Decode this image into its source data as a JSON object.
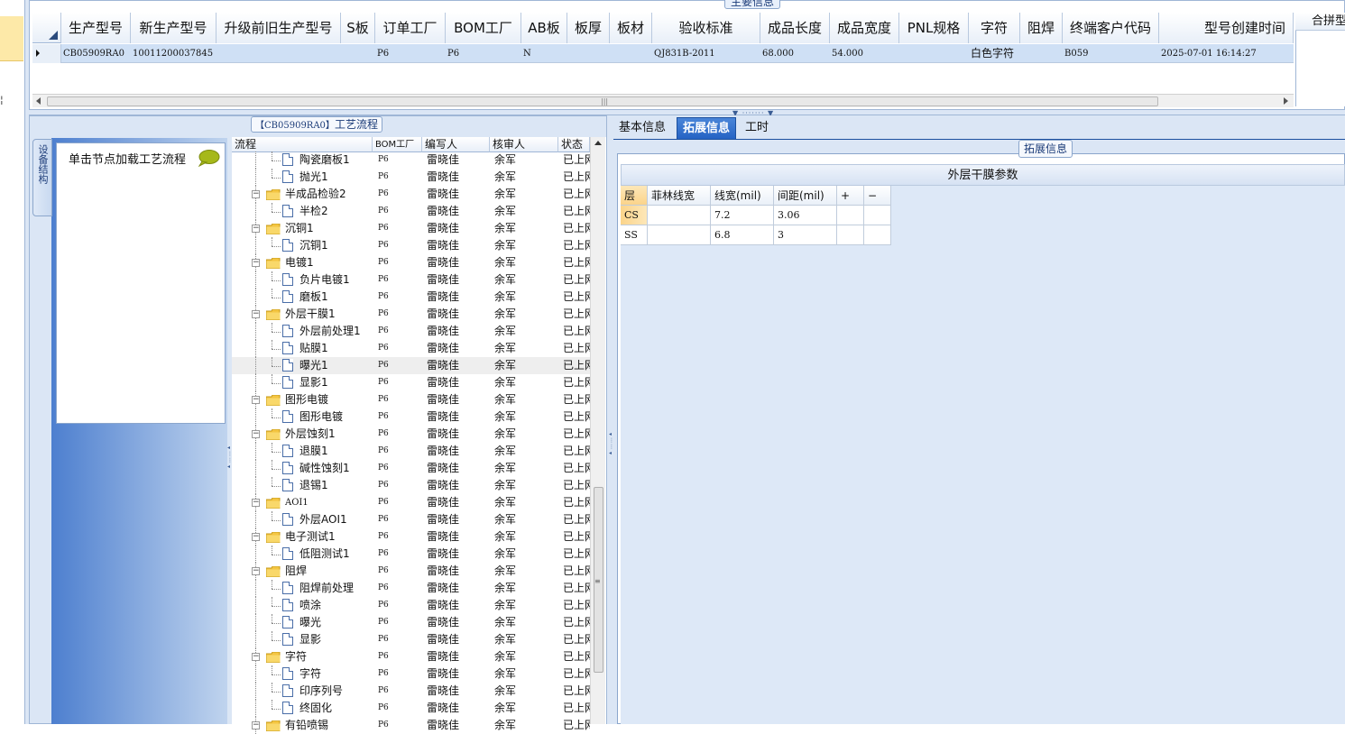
{
  "left_strip": {
    "glyph": "¦"
  },
  "top_group": {
    "title": "主要信息",
    "columns": [
      "生产型号",
      "新生产型号",
      "升级前旧生产型号",
      "S板",
      "订单工厂",
      "BOM工厂",
      "AB板",
      "板厚",
      "板材",
      "验收标准",
      "成品长度",
      "成品宽度",
      "PNL规格",
      "字符",
      "阻焊",
      "终端客户代码",
      "型号创建时间"
    ],
    "row": {
      "prod_model": "CB05909RA0",
      "new_model": "10011200037845",
      "old_model": "",
      "s_board": "",
      "order_factory": "P6",
      "bom_factory": "P6",
      "ab_board": "N",
      "thickness": "",
      "material": "",
      "standard": "QJ831B-2011",
      "length": "68.000",
      "width": "54.000",
      "pnl": "",
      "char": "白色字符",
      "solder": "",
      "customer_code": "B059",
      "created": "2025-07-01 16:14:27"
    },
    "merge_header": "合拼型"
  },
  "flow_group": {
    "title_code": "【CB05909RA0】",
    "title_text": "工艺流程",
    "vtab_label": "设备结构",
    "hint": "单击节点加载工艺流程",
    "columns": {
      "process": "流程",
      "bom": "BOM工厂",
      "writer": "编写人",
      "reviewer": "核审人",
      "status": "状态"
    },
    "rows": [
      {
        "name": "陶瓷磨板1",
        "level": 2,
        "factory": "P6",
        "writer": "雷晓佳",
        "reviewer": "余军",
        "status": "已上网"
      },
      {
        "name": "抛光1",
        "level": 2,
        "factory": "P6",
        "writer": "雷晓佳",
        "reviewer": "余军",
        "status": "已上网"
      },
      {
        "name": "半成品检验2",
        "level": 1,
        "factory": "P6",
        "writer": "雷晓佳",
        "reviewer": "余军",
        "status": "已上网"
      },
      {
        "name": "半检2",
        "level": 2,
        "factory": "P6",
        "writer": "雷晓佳",
        "reviewer": "余军",
        "status": "已上网"
      },
      {
        "name": "沉铜1",
        "level": 1,
        "factory": "P6",
        "writer": "雷晓佳",
        "reviewer": "余军",
        "status": "已上网"
      },
      {
        "name": "沉铜1",
        "level": 2,
        "factory": "P6",
        "writer": "雷晓佳",
        "reviewer": "余军",
        "status": "已上网"
      },
      {
        "name": "电镀1",
        "level": 1,
        "factory": "P6",
        "writer": "雷晓佳",
        "reviewer": "余军",
        "status": "已上网"
      },
      {
        "name": "负片电镀1",
        "level": 2,
        "factory": "P6",
        "writer": "雷晓佳",
        "reviewer": "余军",
        "status": "已上网"
      },
      {
        "name": "磨板1",
        "level": 2,
        "factory": "P6",
        "writer": "雷晓佳",
        "reviewer": "余军",
        "status": "已上网"
      },
      {
        "name": "外层干膜1",
        "level": 1,
        "factory": "P6",
        "writer": "雷晓佳",
        "reviewer": "余军",
        "status": "已上网"
      },
      {
        "name": "外层前处理1",
        "level": 2,
        "factory": "P6",
        "writer": "雷晓佳",
        "reviewer": "余军",
        "status": "已上网"
      },
      {
        "name": "贴膜1",
        "level": 2,
        "factory": "P6",
        "writer": "雷晓佳",
        "reviewer": "余军",
        "status": "已上网"
      },
      {
        "name": "曝光1",
        "level": 2,
        "factory": "P6",
        "writer": "雷晓佳",
        "reviewer": "余军",
        "status": "已上网",
        "selected": true
      },
      {
        "name": "显影1",
        "level": 2,
        "factory": "P6",
        "writer": "雷晓佳",
        "reviewer": "余军",
        "status": "已上网"
      },
      {
        "name": "图形电镀",
        "level": 1,
        "factory": "P6",
        "writer": "雷晓佳",
        "reviewer": "余军",
        "status": "已上网"
      },
      {
        "name": "图形电镀",
        "level": 2,
        "factory": "P6",
        "writer": "雷晓佳",
        "reviewer": "余军",
        "status": "已上网"
      },
      {
        "name": "外层蚀刻1",
        "level": 1,
        "factory": "P6",
        "writer": "雷晓佳",
        "reviewer": "余军",
        "status": "已上网"
      },
      {
        "name": "退膜1",
        "level": 2,
        "factory": "P6",
        "writer": "雷晓佳",
        "reviewer": "余军",
        "status": "已上网"
      },
      {
        "name": "碱性蚀刻1",
        "level": 2,
        "factory": "P6",
        "writer": "雷晓佳",
        "reviewer": "余军",
        "status": "已上网"
      },
      {
        "name": "退锡1",
        "level": 2,
        "factory": "P6",
        "writer": "雷晓佳",
        "reviewer": "余军",
        "status": "已上网"
      },
      {
        "name": "AOI1",
        "level": 1,
        "factory": "P6",
        "writer": "雷晓佳",
        "reviewer": "余军",
        "status": "已上网"
      },
      {
        "name": "外层AOI1",
        "level": 2,
        "factory": "P6",
        "writer": "雷晓佳",
        "reviewer": "余军",
        "status": "已上网"
      },
      {
        "name": "电子测试1",
        "level": 1,
        "factory": "P6",
        "writer": "雷晓佳",
        "reviewer": "余军",
        "status": "已上网"
      },
      {
        "name": "低阻测试1",
        "level": 2,
        "factory": "P6",
        "writer": "雷晓佳",
        "reviewer": "余军",
        "status": "已上网"
      },
      {
        "name": "阻焊",
        "level": 1,
        "factory": "P6",
        "writer": "雷晓佳",
        "reviewer": "余军",
        "status": "已上网"
      },
      {
        "name": "阻焊前处理",
        "level": 2,
        "factory": "P6",
        "writer": "雷晓佳",
        "reviewer": "余军",
        "status": "已上网"
      },
      {
        "name": "喷涂",
        "level": 2,
        "factory": "P6",
        "writer": "雷晓佳",
        "reviewer": "余军",
        "status": "已上网"
      },
      {
        "name": "曝光",
        "level": 2,
        "factory": "P6",
        "writer": "雷晓佳",
        "reviewer": "余军",
        "status": "已上网"
      },
      {
        "name": "显影",
        "level": 2,
        "factory": "P6",
        "writer": "雷晓佳",
        "reviewer": "余军",
        "status": "已上网"
      },
      {
        "name": "字符",
        "level": 1,
        "factory": "P6",
        "writer": "雷晓佳",
        "reviewer": "余军",
        "status": "已上网"
      },
      {
        "name": "字符",
        "level": 2,
        "factory": "P6",
        "writer": "雷晓佳",
        "reviewer": "余军",
        "status": "已上网"
      },
      {
        "name": "印序列号",
        "level": 2,
        "factory": "P6",
        "writer": "雷晓佳",
        "reviewer": "余军",
        "status": "已上网"
      },
      {
        "name": "终固化",
        "level": 2,
        "factory": "P6",
        "writer": "雷晓佳",
        "reviewer": "余军",
        "status": "已上网"
      },
      {
        "name": "有铅喷锡",
        "level": 1,
        "factory": "P6",
        "writer": "雷晓佳",
        "reviewer": "余军",
        "status": "已上网"
      }
    ]
  },
  "tabs": [
    {
      "label": "基本信息",
      "active": false
    },
    {
      "label": "拓展信息",
      "active": true
    },
    {
      "label": "工时",
      "active": false
    }
  ],
  "ext": {
    "group_title": "拓展信息",
    "table_title": "外层干膜参数",
    "headers": [
      "层",
      "菲林线宽",
      "线宽(mil)",
      "间距(mil)",
      "+",
      "−"
    ],
    "rows": [
      {
        "layer": "CS",
        "film": "",
        "line_width": "7.2",
        "spacing": "3.06"
      },
      {
        "layer": "SS",
        "film": "",
        "line_width": "6.8",
        "spacing": "3"
      }
    ]
  },
  "colors": {
    "accent": "#2563c4",
    "folder": "#f4c542",
    "selection": "#cfe0f5"
  }
}
